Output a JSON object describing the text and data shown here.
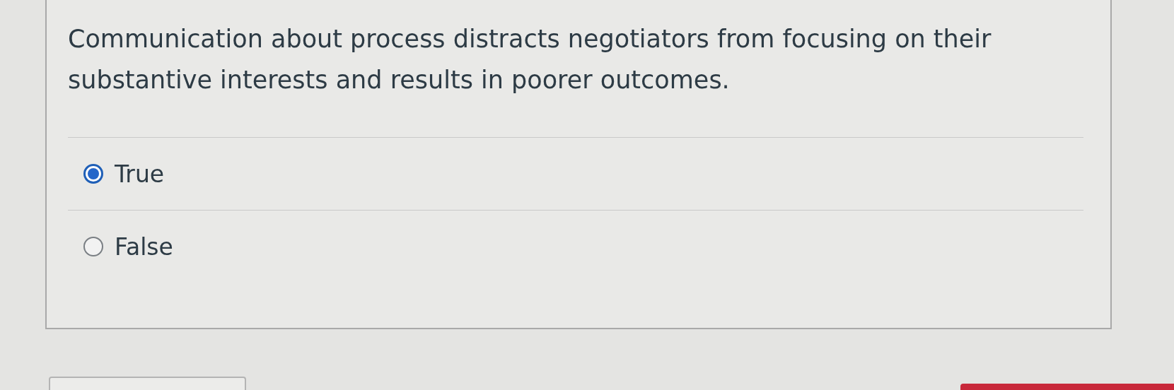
{
  "question": {
    "text": "Communication about process distracts negotiators from focusing on their substantive interests and results in poorer outcomes.",
    "options": [
      {
        "label": "True",
        "selected": true
      },
      {
        "label": "False",
        "selected": false
      }
    ]
  }
}
